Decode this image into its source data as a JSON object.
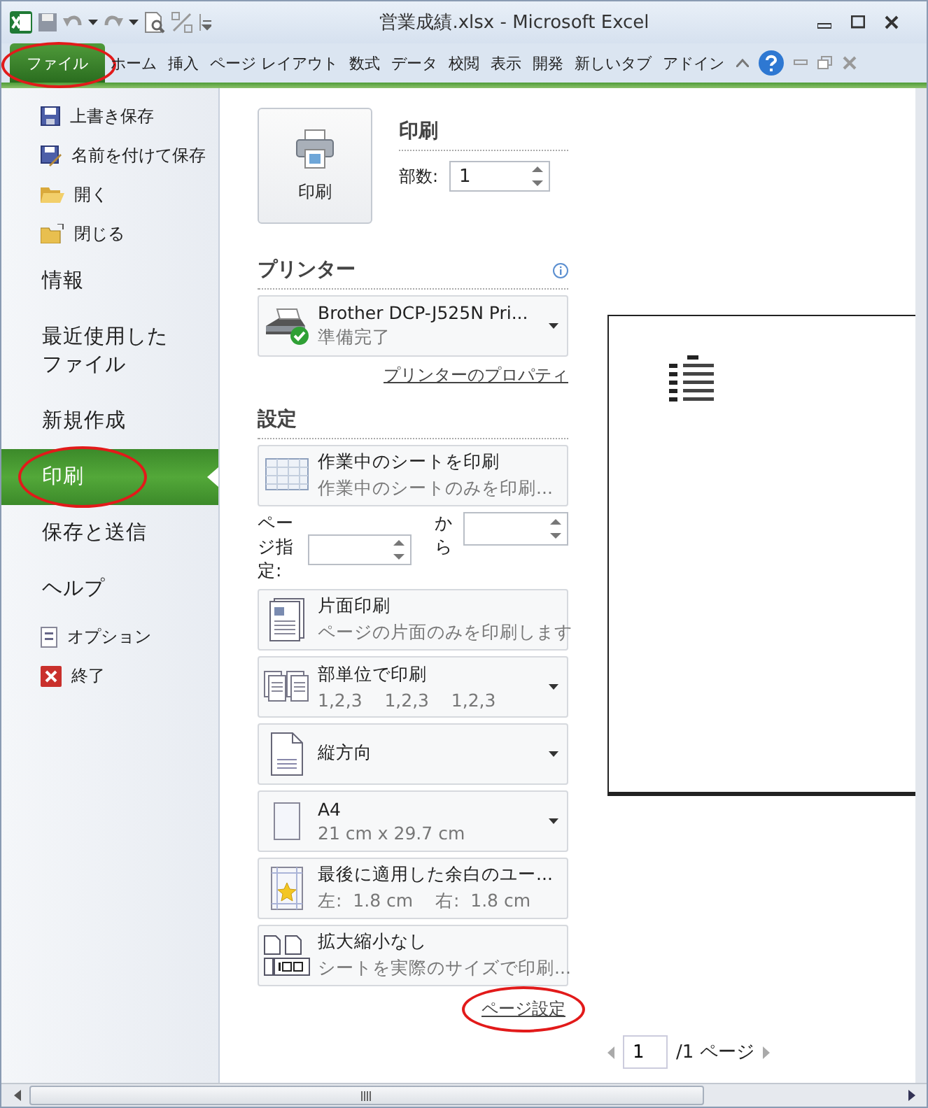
{
  "window": {
    "title": "営業成績.xlsx - Microsoft Excel"
  },
  "ribbon_tabs": [
    {
      "label": "ファイル",
      "selected": true,
      "circled": true
    },
    {
      "label": "ホーム",
      "selected": false,
      "circled": false
    },
    {
      "label": "挿入",
      "selected": false,
      "circled": false
    },
    {
      "label": "ページ レイアウト",
      "selected": false,
      "circled": false
    },
    {
      "label": "数式",
      "selected": false,
      "circled": false
    },
    {
      "label": "データ",
      "selected": false,
      "circled": false
    },
    {
      "label": "校閲",
      "selected": false,
      "circled": false
    },
    {
      "label": "表示",
      "selected": false,
      "circled": false
    },
    {
      "label": "開発",
      "selected": false,
      "circled": false
    },
    {
      "label": "新しいタブ",
      "selected": false,
      "circled": false
    },
    {
      "label": "アドイン",
      "selected": false,
      "circled": false
    }
  ],
  "nav": [
    {
      "kind": "command",
      "label": "上書き保存",
      "selected": false,
      "circled": false
    },
    {
      "kind": "command",
      "label": "名前を付けて保存",
      "selected": false,
      "circled": false
    },
    {
      "kind": "command",
      "label": "開く",
      "selected": false,
      "circled": false
    },
    {
      "kind": "command",
      "label": "閉じる",
      "selected": false,
      "circled": false
    },
    {
      "kind": "section",
      "label": "情報",
      "selected": false,
      "circled": false
    },
    {
      "kind": "section",
      "label": "最近使用したファイル",
      "selected": false,
      "circled": false
    },
    {
      "kind": "section",
      "label": "新規作成",
      "selected": false,
      "circled": false
    },
    {
      "kind": "section",
      "label": "印刷",
      "selected": true,
      "circled": true
    },
    {
      "kind": "section",
      "label": "保存と送信",
      "selected": false,
      "circled": false
    },
    {
      "kind": "section",
      "label": "ヘルプ",
      "selected": false,
      "circled": false
    },
    {
      "kind": "command",
      "label": "オプション",
      "selected": false,
      "circled": false
    },
    {
      "kind": "command",
      "label": "終了",
      "selected": false,
      "circled": false
    }
  ],
  "print": {
    "button_label": "印刷",
    "heading": "印刷",
    "copies_label": "部数:",
    "copies": "1"
  },
  "printer": {
    "heading": "プリンター",
    "name": "Brother DCP-J525N Pri...",
    "status": "準備完了",
    "properties_link": "プリンターのプロパティ"
  },
  "settings": {
    "heading": "設定",
    "items": [
      {
        "kind": "dropdown",
        "title": "作業中のシートを印刷",
        "subtitle": "作業中のシートのみを印刷..."
      },
      {
        "kind": "range",
        "label": "ページ指定:",
        "to_label": "から"
      },
      {
        "kind": "dropdown",
        "title": "片面印刷",
        "subtitle": "ページの片面のみを印刷します"
      },
      {
        "kind": "dropdown",
        "title": "部単位で印刷",
        "subtitle": "1,2,3    1,2,3    1,2,3"
      },
      {
        "kind": "dropdown",
        "title": "縦方向"
      },
      {
        "kind": "dropdown",
        "title": "A4",
        "subtitle": "21 cm x 29.7 cm"
      },
      {
        "kind": "dropdown",
        "title": "最後に適用した余白のユー...",
        "subtitle": "左:  1.8 cm    右:  1.8 cm"
      },
      {
        "kind": "dropdown",
        "title": "拡大縮小なし",
        "subtitle": "シートを実際のサイズで印刷..."
      }
    ]
  },
  "page_setup_link": {
    "label": "ページ設定",
    "circled": true
  },
  "preview": {
    "page_input": "1",
    "page_total": "/1 ページ"
  }
}
